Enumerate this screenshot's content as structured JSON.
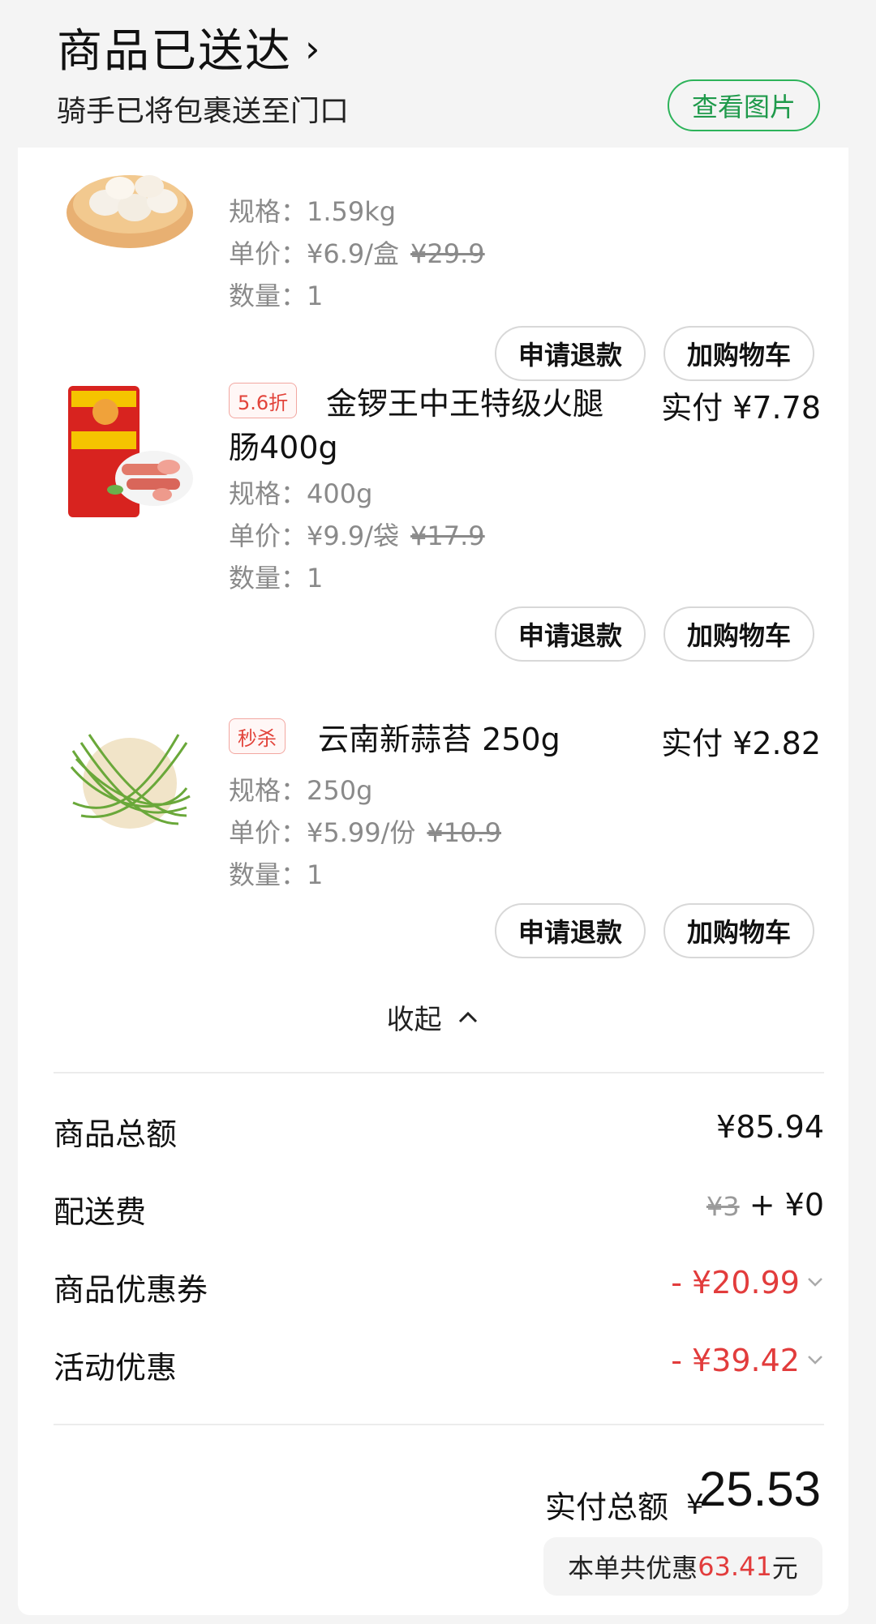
{
  "header": {
    "title": "商品已送达",
    "subtitle": "骑手已将包裹送至门口",
    "photo_button": "查看图片"
  },
  "items": [
    {
      "spec": "规格：1.59kg",
      "unit_price": "单价：¥6.9/盒",
      "original_price": "¥29.9",
      "quantity": "数量：1",
      "refund_button": "申请退款",
      "cart_button": "加购物车"
    },
    {
      "tag": "5.6折",
      "name_line1": "金锣王中王特级火腿",
      "name_line2": "肠400g",
      "paid": "实付 ¥7.78",
      "spec": "规格：400g",
      "unit_price": "单价：¥9.9/袋",
      "original_price": "¥17.9",
      "quantity": "数量：1",
      "refund_button": "申请退款",
      "cart_button": "加购物车"
    },
    {
      "tag": "秒杀",
      "name_line1": "云南新蒜苔 250g",
      "paid": "实付 ¥2.82",
      "spec": "规格：250g",
      "unit_price": "单价：¥5.99/份",
      "original_price": "¥10.9",
      "quantity": "数量：1",
      "refund_button": "申请退款",
      "cart_button": "加购物车"
    }
  ],
  "collapse_label": "收起",
  "summary": {
    "goods_total_label": "商品总额",
    "goods_total_value": "¥85.94",
    "delivery_label": "配送费",
    "delivery_original": "¥3",
    "delivery_value": "+ ¥0",
    "coupon_label": "商品优惠券",
    "coupon_value": "- ¥20.99",
    "promo_label": "活动优惠",
    "promo_value": "- ¥39.42",
    "paid_total_label": "实付总额",
    "paid_currency": "¥",
    "paid_total_value": "25.53",
    "saving_prefix": "本单共优惠",
    "saving_amount": "63.41",
    "saving_suffix": "元"
  },
  "colors": {
    "accent_green": "#2db35a",
    "discount_red": "#e23c3c"
  }
}
